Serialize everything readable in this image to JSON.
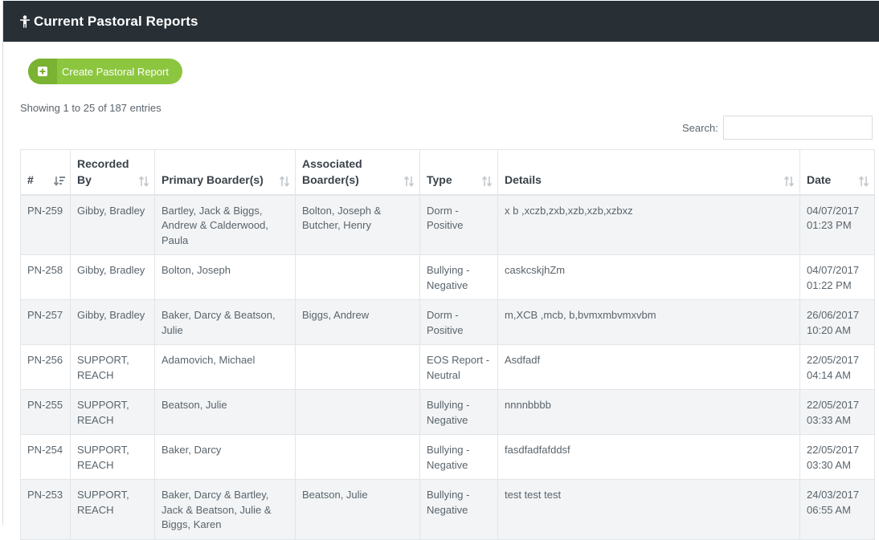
{
  "panel": {
    "title": "Current Pastoral Reports",
    "icon": "person-icon"
  },
  "create_button": {
    "label": "Create Pastoral Report",
    "icon": "plus-square-icon",
    "color": "#8cc63f"
  },
  "info": "Showing 1 to 25 of 187 entries",
  "search": {
    "label": "Search:",
    "value": ""
  },
  "table": {
    "columns": [
      "#",
      "Recorded By",
      "Primary Boarder(s)",
      "Associated Boarder(s)",
      "Type",
      "Details",
      "Date"
    ],
    "rows": [
      {
        "id": "PN-259",
        "recorded_by": "Gibby, Bradley",
        "primary": "Bartley, Jack & Biggs, Andrew & Calderwood, Paula",
        "associated": "Bolton, Joseph & Butcher, Henry",
        "type": "Dorm - Positive",
        "details": "x b ,xczb,zxb,xzb,xzb,xzbxz",
        "date": "04/07/2017",
        "time": "01:23 PM"
      },
      {
        "id": "PN-258",
        "recorded_by": "Gibby, Bradley",
        "primary": "Bolton, Joseph",
        "associated": "",
        "type": "Bullying - Negative",
        "details": "caskcskjhZm",
        "date": "04/07/2017",
        "time": "01:22 PM"
      },
      {
        "id": "PN-257",
        "recorded_by": "Gibby, Bradley",
        "primary": "Baker, Darcy & Beatson, Julie",
        "associated": "Biggs, Andrew",
        "type": "Dorm - Positive",
        "details": "m,XCB ,mcb, b,bvmxmbvmxvbm",
        "date": "26/06/2017",
        "time": "10:20 AM"
      },
      {
        "id": "PN-256",
        "recorded_by": "SUPPORT, REACH",
        "primary": "Adamovich, Michael",
        "associated": "",
        "type": "EOS Report - Neutral",
        "details": "Asdfadf",
        "date": "22/05/2017",
        "time": "04:14 AM"
      },
      {
        "id": "PN-255",
        "recorded_by": "SUPPORT, REACH",
        "primary": "Beatson, Julie",
        "associated": "",
        "type": "Bullying - Negative",
        "details": "nnnnbbbb",
        "date": "22/05/2017",
        "time": "03:33 AM"
      },
      {
        "id": "PN-254",
        "recorded_by": "SUPPORT, REACH",
        "primary": "Baker, Darcy",
        "associated": "",
        "type": "Bullying - Negative",
        "details": "fasdfadfafddsf",
        "date": "22/05/2017",
        "time": "03:30 AM"
      },
      {
        "id": "PN-253",
        "recorded_by": "SUPPORT, REACH",
        "primary": "Baker, Darcy & Bartley, Jack & Beatson, Julie & Biggs, Karen",
        "associated": "Beatson, Julie",
        "type": "Bullying - Negative",
        "details": "test test test",
        "date": "24/03/2017",
        "time": "06:55 AM"
      }
    ]
  }
}
